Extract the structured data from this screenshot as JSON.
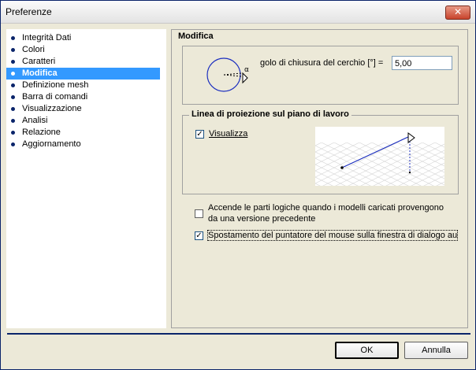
{
  "window": {
    "title": "Preferenze"
  },
  "sidebar": {
    "items": [
      {
        "label": "Integrità Dati"
      },
      {
        "label": "Colori"
      },
      {
        "label": "Caratteri"
      },
      {
        "label": "Modifica",
        "selected": true
      },
      {
        "label": "Definizione mesh"
      },
      {
        "label": "Barra di comandi"
      },
      {
        "label": "Visualizzazione"
      },
      {
        "label": "Analisi"
      },
      {
        "label": "Relazione"
      },
      {
        "label": "Aggiornamento"
      }
    ]
  },
  "main": {
    "title": "Modifica",
    "circle_group": {
      "label": "golo di chiusura del cerchio [°] =",
      "value": "5,00",
      "alpha_symbol": "α"
    },
    "projection_group": {
      "legend": "Linea di proiezione sul piano di lavoro",
      "checkbox_label": "Visualizza",
      "checkbox_checked": true
    },
    "options": [
      {
        "label_line1": "Accende le parti logiche quando i modelli caricati provengono",
        "label_line2": "da una versione precedente",
        "checked": false
      },
      {
        "label_line1": "Spostamento del puntatore del mouse sulla finestra di dialogo au",
        "checked": true
      }
    ]
  },
  "buttons": {
    "ok": "OK",
    "cancel": "Annulla"
  },
  "icons": {
    "close": "close-icon",
    "bullet": "bullet-icon"
  },
  "colors": {
    "selection": "#3399ff",
    "accent": "#0a246a"
  }
}
